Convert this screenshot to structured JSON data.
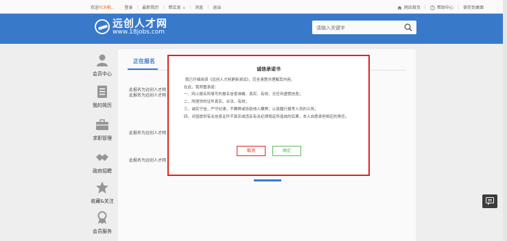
{
  "topbar": {
    "welcome_prefix": "欢迎",
    "username": "YCR帆...",
    "login": "登录",
    "latest_resume": "最新简历",
    "recruit": "帮店发",
    "messages": "消息",
    "logout": "退出",
    "site_home": "网站首页",
    "help_center": "帮助中心",
    "save_desktop": "保存到桌面"
  },
  "header": {
    "logo_cn": "远创人才网",
    "logo_en": "www.18jobs.com",
    "search_placeholder": "请输入关键字"
  },
  "sidebar": {
    "items": [
      {
        "label": "会员中心",
        "icon": "person-icon"
      },
      {
        "label": "我的简历",
        "icon": "resume-icon"
      },
      {
        "label": "求职管理",
        "icon": "briefcase-icon"
      },
      {
        "label": "政府招聘",
        "icon": "handshake-icon"
      },
      {
        "label": "收藏&关注",
        "icon": "star-icon"
      },
      {
        "label": "会员服务",
        "icon": "medal-icon"
      }
    ]
  },
  "main": {
    "tab": "正在报名",
    "registrations": [
      "此报名为远创人才网",
      "此报名为远创人才网",
      "此报名为远创人才网",
      "此报名为远创人才网"
    ]
  },
  "modal": {
    "title": "诚信承诺书",
    "lines": [
      "我已仔细阅读《远创人才网更新测试》，完全清楚并理解其内容。",
      "在此，我郑重承诺：",
      "一、网上报名所填写的报名信息准确、真实、有效、无任何虚假信息；",
      "二、所提供的证件真实、合法、有效；",
      "三、诚实守信，严守纪律，不舞弊或协助他人舞弊；认真履行报考人员的义务；",
      "四、对因提供有关信息证件不真实或违反有关纪律规定所造成的后果，本人自愿承担相应的责任。"
    ],
    "cancel": "取消",
    "confirm": "确定"
  },
  "colors": {
    "header_blue": "#3b7ccf",
    "modal_border": "#e02020",
    "cancel": "#e02020",
    "confirm": "#5cb85c"
  }
}
